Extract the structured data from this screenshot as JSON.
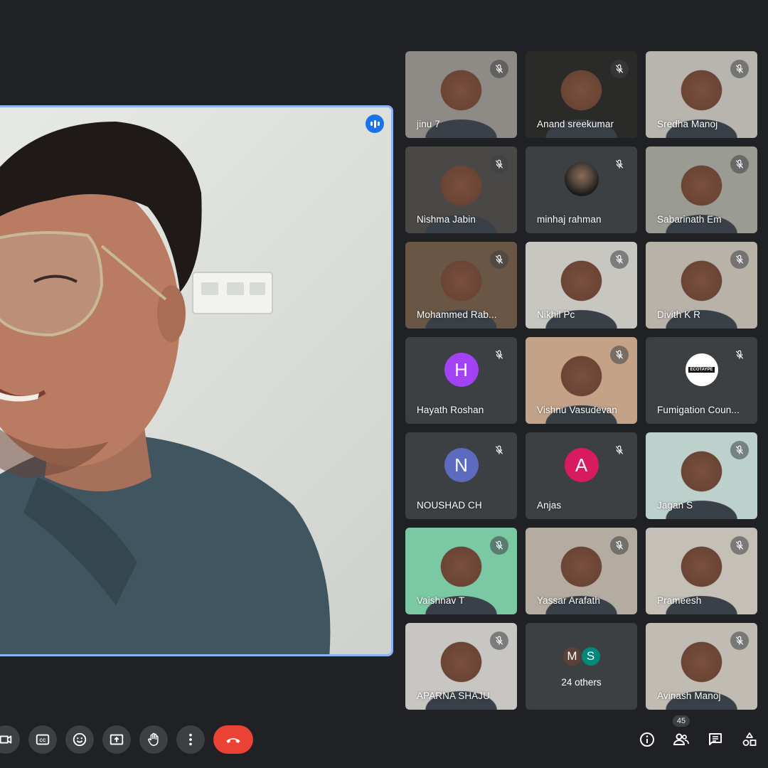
{
  "main_speaker": {
    "speaking": true
  },
  "participants": [
    {
      "name": "jinu 7",
      "type": "video",
      "bg": "#8e8a85"
    },
    {
      "name": "Anand sreekumar",
      "type": "video",
      "bg": "#2a2a28"
    },
    {
      "name": "Sredha Manoj",
      "type": "video",
      "bg": "#b8b4ae"
    },
    {
      "name": "Nishma Jabin",
      "type": "video",
      "bg": "#4a4846"
    },
    {
      "name": "minhaj rahman",
      "type": "photo",
      "bg": "#3c4043"
    },
    {
      "name": "Sabarinath Em",
      "type": "video",
      "bg": "#9a9c94"
    },
    {
      "name": "Mohammed Rab...",
      "type": "video",
      "bg": "#6a5644"
    },
    {
      "name": "Nikhil Pc",
      "type": "video",
      "bg": "#c8c6c0"
    },
    {
      "name": "Divith K R",
      "type": "video",
      "bg": "#b8b2a8"
    },
    {
      "name": "Hayath Roshan",
      "type": "letter",
      "letter": "H",
      "color": "#a142f4"
    },
    {
      "name": "Vishnu Vasudevan",
      "type": "video",
      "bg": "#c4a288"
    },
    {
      "name": "Fumigation Coun...",
      "type": "logo",
      "logo_text": "ECOTAYPE"
    },
    {
      "name": "NOUSHAD CH",
      "type": "letter",
      "letter": "N",
      "color": "#5c6bc0"
    },
    {
      "name": "Anjas",
      "type": "letter",
      "letter": "A",
      "color": "#d81b60"
    },
    {
      "name": "Jagan S",
      "type": "video",
      "bg": "#bcd0cc"
    },
    {
      "name": "Vaishnav T",
      "type": "video",
      "bg": "#7bc8a4"
    },
    {
      "name": "Yassar Arafath",
      "type": "video",
      "bg": "#b4aca0"
    },
    {
      "name": "Prameesh",
      "type": "video",
      "bg": "#c4c0b8"
    },
    {
      "name": "APARNA SHAJU",
      "type": "video",
      "bg": "#c8c6c2"
    },
    {
      "name": "24 others",
      "type": "others",
      "avatars": [
        {
          "letter": "M",
          "color": "#5d4037"
        },
        {
          "letter": "S",
          "color": "#00897b"
        }
      ]
    },
    {
      "name": "Avinash Manoj",
      "type": "video",
      "bg": "#c0bcb4"
    }
  ],
  "controls": {
    "icons": [
      "camera-icon",
      "captions-icon",
      "emoji-icon",
      "present-icon",
      "raise-hand-icon",
      "more-options-icon"
    ],
    "end_call_color": "#ea4335"
  },
  "right_controls": {
    "people_count": "45"
  }
}
